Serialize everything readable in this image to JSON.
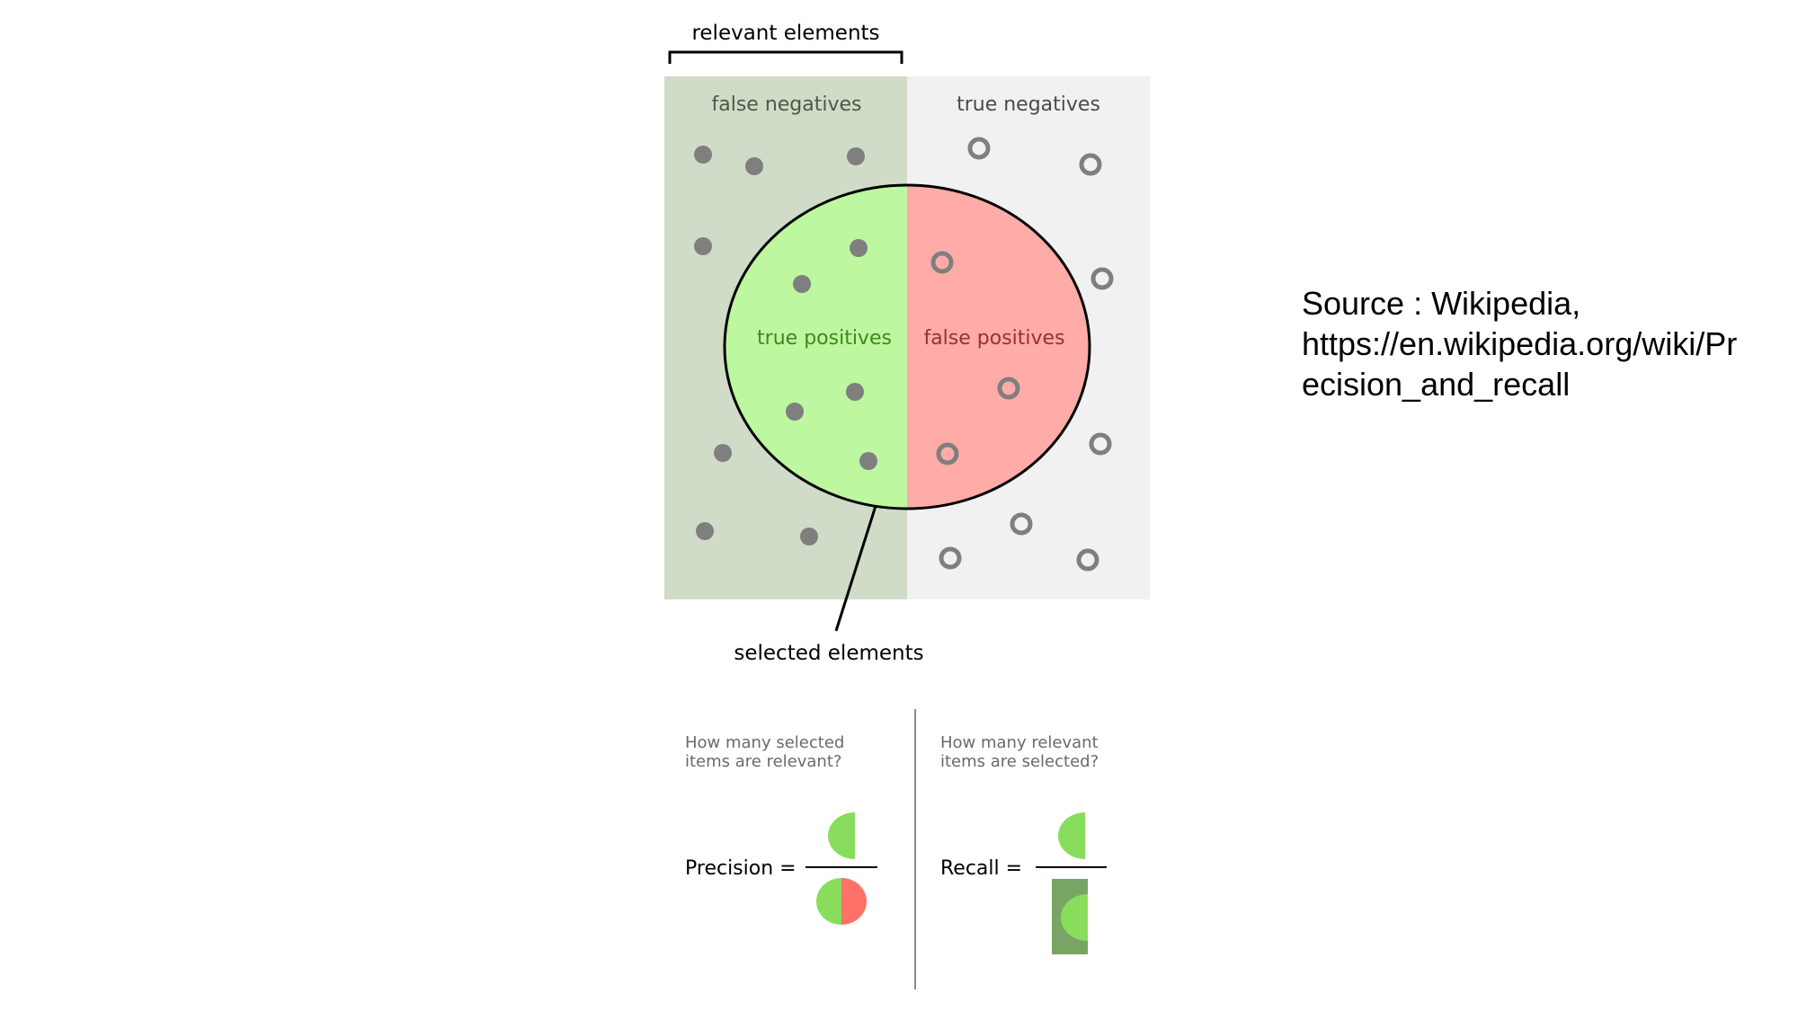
{
  "labels": {
    "relevant_elements": "relevant elements",
    "false_negatives": "false negatives",
    "true_negatives": "true negatives",
    "true_positives": "true positives",
    "false_positives": "false positives",
    "selected_elements": "selected elements"
  },
  "precision": {
    "question_line1": "How many selected",
    "question_line2": "items are relevant?",
    "label": "Precision ="
  },
  "recall": {
    "question_line1": "How many relevant",
    "question_line2": "items are selected?",
    "label": "Recall ="
  },
  "source": {
    "line1": "Source : Wikipedia,",
    "line2": "https://en.wikipedia.org/wiki/Pr",
    "line3": "ecision_and_recall"
  },
  "colors": {
    "relevant_bg": "#d0dcc8",
    "irrelevant_bg": "#f1f1f1",
    "true_positive": "#bdf7a0",
    "false_positive": "#ffaca8",
    "dot": "#7f7f7f",
    "formula_green": "#88dd5c",
    "formula_red": "#ff7066",
    "recall_rect": "#78a565",
    "fn_text": "#4b5a46",
    "tn_text": "#4a4a4a",
    "tp_text": "#3c8a1c",
    "fp_text": "#9c2f2f",
    "question_text": "#6a6a6a"
  },
  "icons": [
    "relevant-dot-icon",
    "irrelevant-circle-icon",
    "half-circle-icon",
    "whole-circle-icon"
  ]
}
